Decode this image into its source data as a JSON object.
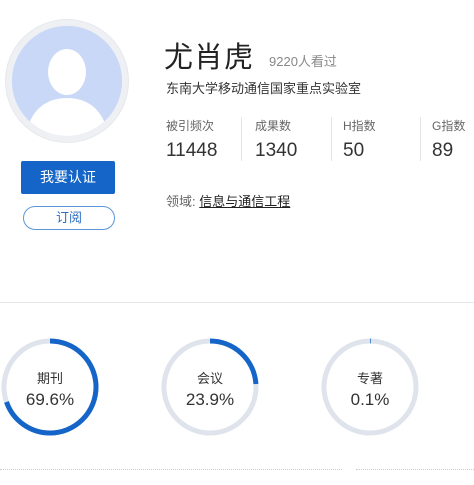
{
  "profile": {
    "name": "尤肖虎",
    "views": "9220人看过",
    "organization": "东南大学移动通信国家重点实验室",
    "verify_label": "我要认证",
    "subscribe_label": "订阅"
  },
  "stats": [
    {
      "label": "被引频次",
      "value": "11448"
    },
    {
      "label": "成果数",
      "value": "1340"
    },
    {
      "label": "H指数",
      "value": "50"
    },
    {
      "label": "G指数",
      "value": "89"
    }
  ],
  "field": {
    "label": "领域:",
    "value": "信息与通信工程"
  },
  "distribution": [
    {
      "label": "期刊",
      "display": "69.6%",
      "percent": 69.6
    },
    {
      "label": "会议",
      "display": "23.9%",
      "percent": 23.9
    },
    {
      "label": "专著",
      "display": "0.1%",
      "percent": 0.1
    }
  ],
  "colors": {
    "accent": "#1565c8",
    "ring_track": "#dfe4ec",
    "avatar_bg": "#c9d8f7"
  }
}
